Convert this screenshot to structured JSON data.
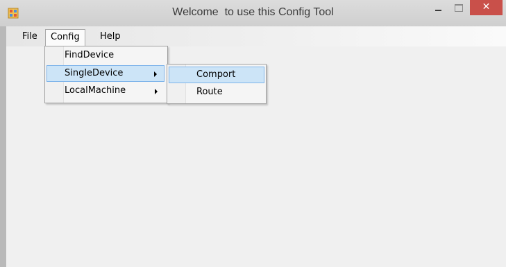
{
  "window": {
    "title": "Welcome  to use this Config Tool",
    "close_glyph": "✕",
    "app_icon": "app-icon",
    "accent_close": "#c9504a"
  },
  "menubar": {
    "items": [
      {
        "label": "File"
      },
      {
        "label": "Config"
      },
      {
        "label": "Help"
      }
    ]
  },
  "config_menu": {
    "items": [
      {
        "label": "FindDevice",
        "has_submenu": false
      },
      {
        "label": "SingleDevice",
        "has_submenu": true,
        "highlighted": true
      },
      {
        "label": "LocalMachine",
        "has_submenu": true
      }
    ]
  },
  "single_device_submenu": {
    "items": [
      {
        "label": "Comport",
        "highlighted": true
      },
      {
        "label": "Route"
      }
    ]
  },
  "colors": {
    "highlight_fill": "#cce4f7",
    "highlight_border": "#7eb4ea"
  }
}
